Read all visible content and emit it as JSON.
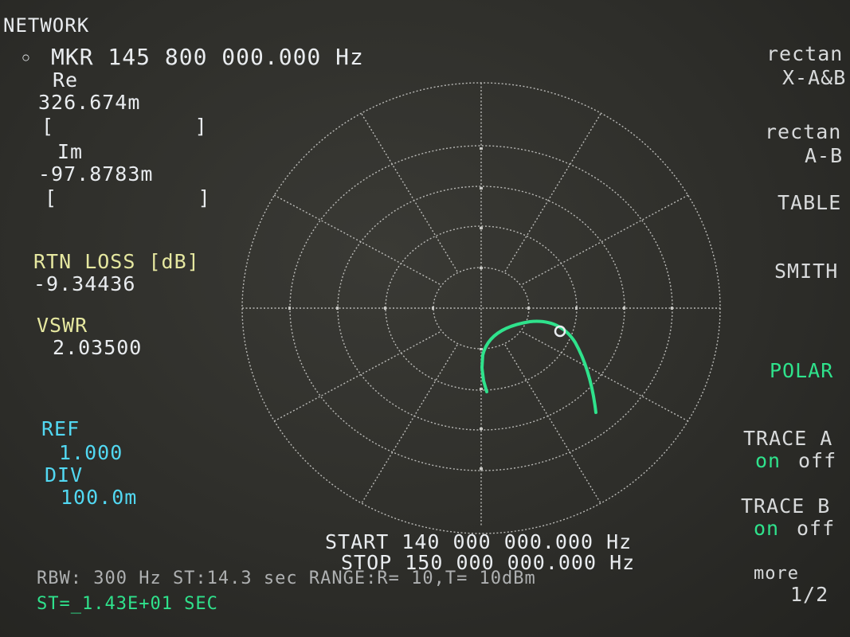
{
  "title": "NETWORK",
  "marker": {
    "symbol": "◦",
    "label": "MKR 145 800 000.000 Hz",
    "re_label": "Re",
    "re_value": "326.674m",
    "re_bracket": "[           ]",
    "im_label": "Im",
    "im_value": "-97.8783m",
    "im_bracket": "[           ]"
  },
  "measurements": {
    "rtn_loss_label": "RTN LOSS [dB]",
    "rtn_loss_value": "-9.34436",
    "vswr_label": "VSWR",
    "vswr_value": "2.03500"
  },
  "scale": {
    "ref_label": "REF",
    "ref_value": "1.000",
    "div_label": "DIV",
    "div_value": "100.0m"
  },
  "softkeys": {
    "rectan_xab_1": "rectan",
    "rectan_xab_2": "X-A&B",
    "rectan_ab_1": "rectan",
    "rectan_ab_2": "A-B",
    "table": "TABLE",
    "smith": "SMITH",
    "polar": "POLAR",
    "trace_a": "TRACE A",
    "trace_a_on": "on",
    "trace_a_off": "off",
    "trace_b": "TRACE B",
    "trace_b_on": "on",
    "trace_b_off": "off",
    "more": "more",
    "more_page": "1/2"
  },
  "sweep": {
    "start": "START 140 000 000.000 Hz",
    "stop": "STOP 150 000 000.000 Hz",
    "status": "RBW: 300 Hz ST:14.3 sec RANGE:R= 10,T= 10dBm",
    "sweep_time": "ST=_1.43E+01 SEC"
  },
  "colors": {
    "text": "#e9ecef",
    "yellow": "#e6e8a0",
    "cyan": "#52d8f2",
    "trace": "#2fe28c",
    "grid": "#b9b9b6"
  }
}
